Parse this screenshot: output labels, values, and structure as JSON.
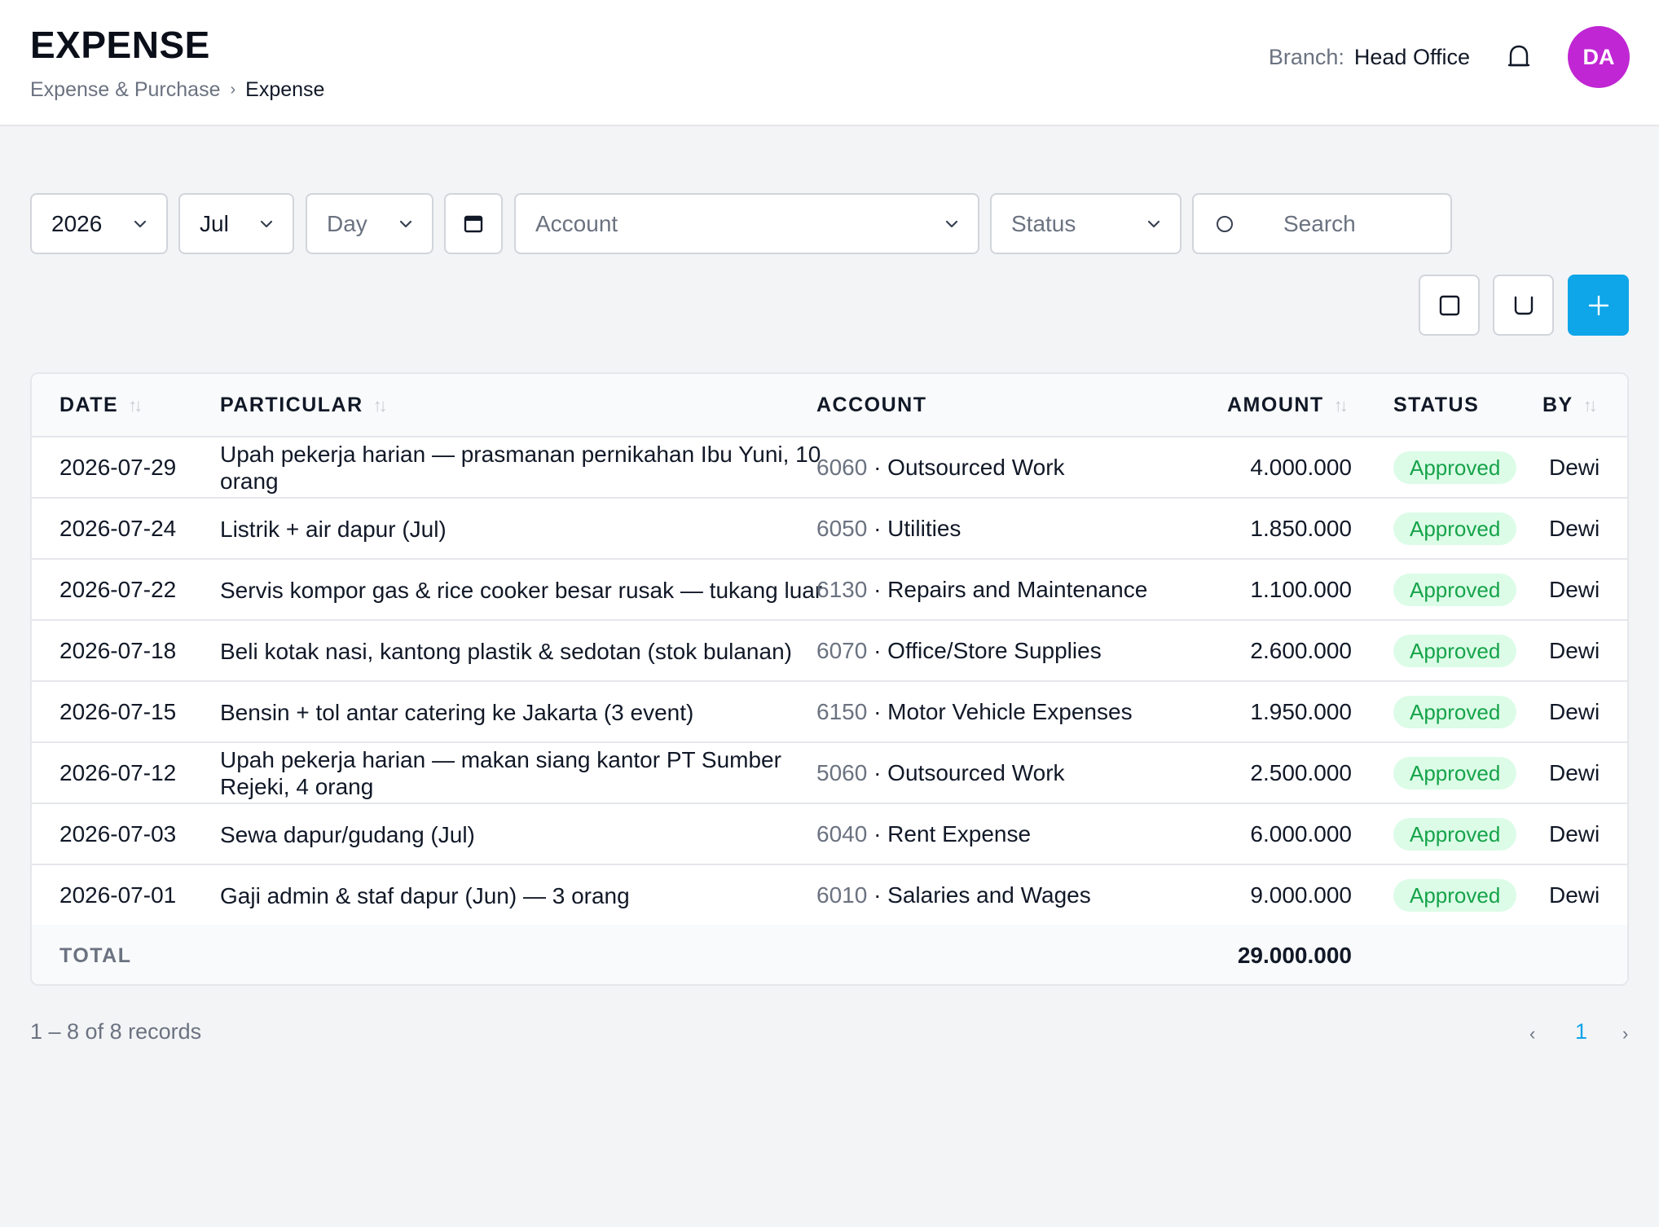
{
  "header": {
    "title": "EXPENSE",
    "breadcrumb": {
      "parent": "Expense & Purchase",
      "separator": "›",
      "current": "Expense"
    },
    "branch_label": "Branch:",
    "branch_value": "Head Office",
    "avatar_initials": "DA",
    "avatar_color": "#c026d3"
  },
  "filters": {
    "year": "2026",
    "month": "Jul",
    "day_placeholder": "Day",
    "account_placeholder": "Account",
    "status_placeholder": "Status",
    "search_placeholder": "Search"
  },
  "accent_color": "#0ea5e9",
  "table": {
    "columns": {
      "date": "DATE",
      "particular": "PARTICULAR",
      "account": "ACCOUNT",
      "amount": "AMOUNT",
      "status": "STATUS",
      "by": "BY"
    },
    "sort_glyph": "↑↓",
    "rows": [
      {
        "date": "2026-07-29",
        "particular": "Upah pekerja harian — prasmanan pernikahan Ibu Yuni, 10 orang",
        "code": "6060",
        "account": "· Outsourced Work",
        "amount": "4.000.000",
        "status": "Approved",
        "by": "Dewi"
      },
      {
        "date": "2026-07-24",
        "particular": "Listrik + air dapur (Jul)",
        "code": "6050",
        "account": "· Utilities",
        "amount": "1.850.000",
        "status": "Approved",
        "by": "Dewi"
      },
      {
        "date": "2026-07-22",
        "particular": "Servis kompor gas & rice cooker besar rusak — tukang luar",
        "code": "6130",
        "account": "· Repairs and Maintenance",
        "amount": "1.100.000",
        "status": "Approved",
        "by": "Dewi"
      },
      {
        "date": "2026-07-18",
        "particular": "Beli kotak nasi, kantong plastik & sedotan (stok bulanan)",
        "code": "6070",
        "account": "· Office/Store Supplies",
        "amount": "2.600.000",
        "status": "Approved",
        "by": "Dewi"
      },
      {
        "date": "2026-07-15",
        "particular": "Bensin + tol antar catering ke Jakarta (3 event)",
        "code": "6150",
        "account": "· Motor Vehicle Expenses",
        "amount": "1.950.000",
        "status": "Approved",
        "by": "Dewi"
      },
      {
        "date": "2026-07-12",
        "particular": "Upah pekerja harian — makan siang kantor PT Sumber Rejeki, 4 orang",
        "code": "5060",
        "account": "· Outsourced Work",
        "amount": "2.500.000",
        "status": "Approved",
        "by": "Dewi"
      },
      {
        "date": "2026-07-03",
        "particular": "Sewa dapur/gudang (Jul)",
        "code": "6040",
        "account": "· Rent Expense",
        "amount": "6.000.000",
        "status": "Approved",
        "by": "Dewi"
      },
      {
        "date": "2026-07-01",
        "particular": "Gaji admin & staf dapur (Jun) — 3 orang",
        "code": "6010",
        "account": "· Salaries and Wages",
        "amount": "9.000.000",
        "status": "Approved",
        "by": "Dewi"
      }
    ],
    "total_label": "TOTAL",
    "total_value": "29.000.000"
  },
  "footer": {
    "records_text": "1 – 8 of 8 records",
    "prev": "‹",
    "page": "1",
    "next": "›"
  }
}
